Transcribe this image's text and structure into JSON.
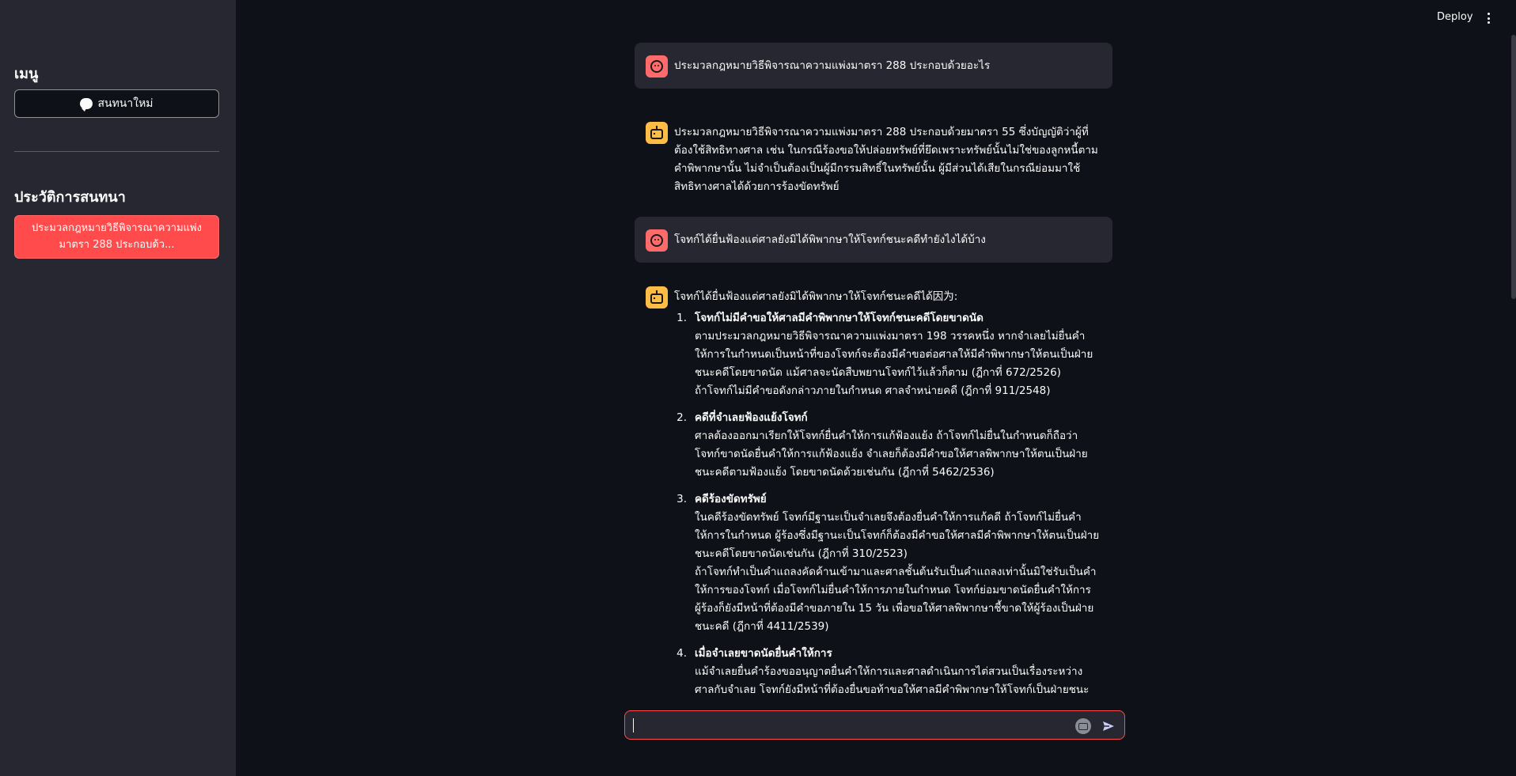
{
  "header": {
    "deploy_label": "Deploy",
    "menu_icon": "kebab-menu-icon"
  },
  "sidebar": {
    "menu_heading": "เมนู",
    "new_chat_label": "สนทนาใหม่",
    "new_chat_icon": "chat-bubble-icon",
    "history_heading": "ประวัติการสนทนา",
    "history_items": [
      {
        "label": "ประมวลกฎหมายวิธีพิจารณาความแพ่งมาตรา 288 ประกอบด้ว..."
      }
    ]
  },
  "chat": {
    "messages": [
      {
        "role": "user",
        "text": "ประมวลกฎหมายวิธีพิจารณาความแพ่งมาตรา 288 ประกอบด้วยอะไร"
      },
      {
        "role": "assistant",
        "text": "ประมวลกฎหมายวิธีพิจารณาความแพ่งมาตรา 288 ประกอบด้วยมาตรา 55 ซึ่งบัญญัติว่าผู้ที่ต้องใช้สิทธิทางศาล เช่น ในกรณีร้องขอให้ปล่อยทรัพย์ที่ยึดเพราะทรัพย์นั้นไม่ใช่ของลูกหนี้ตามคำพิพากษานั้น ไม่จำเป็นต้องเป็นผู้มีกรรมสิทธิ์ในทรัพย์นั้น ผู้มีส่วนได้เสียในกรณีย่อมมาใช้สิทธิทางศาลได้ด้วยการร้องขัดทรัพย์"
      },
      {
        "role": "user",
        "text": "โจทก์ได้ยื่นฟ้องแต่ศาลยังมิได้พิพากษาให้โจทก์ชนะคดีทำยังไงได้บ้าง"
      },
      {
        "role": "assistant",
        "intro": "โจทก์ได้ยื่นฟ้องแต่ศาลยังมิได้พิพากษาให้โจทก์ชนะคดีได้因为:",
        "items": [
          {
            "num": "1.",
            "title": "โจทก์ไม่มีคำขอให้ศาลมีคำพิพากษาให้โจทก์ชนะคดีโดยขาดนัด",
            "body": "ตามประมวลกฎหมายวิธีพิจารณาความแพ่งมาตรา 198 วรรคหนึ่ง หากจำเลยไม่ยื่นคำให้การในกำหนดเป็นหน้าที่ของโจทก์จะต้องมีคำขอต่อศาลให้มีคำพิพากษาให้ตนเป็นฝ่ายชนะคดีโดยขาดนัด แม้ศาลจะนัดสืบพยานโจทก์ไว้แล้วก็ตาม (ฎีกาที่ 672/2526)",
            "body2": "ถ้าโจทก์ไม่มีคำขอดังกล่าวภายในกำหนด ศาลจำหน่ายคดี (ฎีกาที่ 911/2548)"
          },
          {
            "num": "2.",
            "title": "คดีที่จำเลยฟ้องแย้งโจทก์",
            "body": "ศาลต้องออกมาเรียกให้โจทก์ยื่นคำให้การแก้ฟ้องแย้ง ถ้าโจทก์ไม่ยื่นในกำหนดก็ถือว่าโจทก์ขาดนัดยื่นคำให้การแก้ฟ้องแย้ง จำเลยก็ต้องมีคำขอให้ศาลพิพากษาให้ตนเป็นฝ่ายชนะคดีตามฟ้องแย้ง โดยขาดนัดด้วยเช่นกัน (ฎีกาที่ 5462/2536)",
            "body2": ""
          },
          {
            "num": "3.",
            "title": "คดีร้องขัดทรัพย์",
            "body": "ในคดีร้องขัดทรัพย์ โจทก์มีฐานะเป็นจำเลยจึงต้องยื่นคำให้การแก้คดี ถ้าโจทก์ไม่ยื่นคำให้การในกำหนด ผู้ร้องซึ่งมีฐานะเป็นโจทก์ก็ต้องมีคำขอให้ศาลมีคำพิพากษาให้ตนเป็นฝ่ายชนะคดีโดยขาดนัดเช่นกัน (ฎีกาที่ 310/2523)",
            "body2": "ถ้าโจทก์ทำเป็นคำแถลงคัดค้านเข้ามาและศาลชั้นต้นรับเป็นคำแถลงเท่านั้นมิใช่รับเป็นคำให้การของโจทก์ เมื่อโจทก์ไม่ยื่นคำให้การภายในกำหนด โจทก์ย่อมขาดนัดยื่นคำให้การ ผู้ร้องก็ยังมีหน้าที่ต้องมีคำขอภายใน 15 วัน เพื่อขอให้ศาลพิพากษาชี้ขาดให้ผู้ร้องเป็นฝ่ายชนะคดี (ฎีกาที่ 4411/2539)"
          },
          {
            "num": "4.",
            "title": "เมื่อจำเลยขาดนัดยื่นคำให้การ",
            "body": "แม้จำเลยยื่นคำร้องขออนุญาตยื่นคำให้การและศาลดำเนินการไต่สวนเป็นเรื่องระหว่างศาลกับจำเลย โจทก์ยังมีหน้าที่ต้องยื่นขอท้าขอให้ศาลมีคำพิพากษาให้โจทก์เป็นฝ่ายชนะคดีโดย",
            "body2": ""
          }
        ]
      }
    ]
  },
  "input": {
    "placeholder": "",
    "value": "",
    "mic_icon": "mic-icon",
    "send_icon": "send-icon"
  },
  "colors": {
    "accent": "#ff4b4b",
    "sidebar_bg": "#262730",
    "main_bg": "#0e1117",
    "bot_avatar": "#ffbd45",
    "user_avatar": "#ff6b6b"
  }
}
